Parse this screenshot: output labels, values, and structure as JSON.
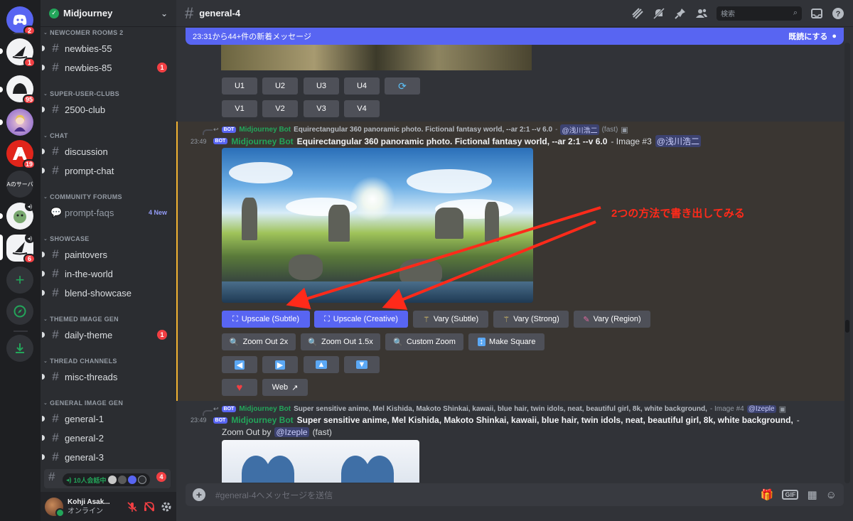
{
  "servers": [
    {
      "name": "discord-home",
      "badge": "2",
      "color": "#5865f2"
    },
    {
      "name": "server-sail",
      "badge": "1",
      "color": "#f2f3f5"
    },
    {
      "name": "server-mono",
      "badge": "95",
      "color": "#f2f3f5"
    },
    {
      "name": "server-portrait",
      "badge": "",
      "color": "#7b5ad0"
    },
    {
      "name": "server-adobe",
      "badge": "19",
      "color": "#e1251b"
    },
    {
      "name": "server-text",
      "label": "Aのサーバ",
      "badge": "",
      "color": "#313338"
    },
    {
      "name": "server-green",
      "badge": "",
      "color": "#5a8a5a"
    },
    {
      "name": "server-midjourney",
      "badge": "6",
      "color": "#f2f3f5"
    }
  ],
  "guild": {
    "name": "Midjourney"
  },
  "categories": [
    "NEWCOMER ROOMS 2",
    "SUPER-USER-CLUBS",
    "CHAT",
    "COMMUNITY FORUMS",
    "SHOWCASE",
    "THEMED IMAGE GEN",
    "THREAD CHANNELS",
    "GENERAL IMAGE GEN"
  ],
  "channels": [
    {
      "name": "newbies-55",
      "count": ""
    },
    {
      "name": "newbies-85",
      "count": "1"
    },
    {
      "name": "2500-club",
      "count": ""
    },
    {
      "name": "discussion",
      "count": ""
    },
    {
      "name": "prompt-chat",
      "count": ""
    },
    {
      "name": "prompt-faqs",
      "count": "",
      "tag": "4 New"
    },
    {
      "name": "paintovers",
      "count": ""
    },
    {
      "name": "in-the-world",
      "count": ""
    },
    {
      "name": "blend-showcase",
      "count": ""
    },
    {
      "name": "daily-theme",
      "count": "1"
    },
    {
      "name": "misc-threads",
      "count": ""
    },
    {
      "name": "general-1",
      "count": ""
    },
    {
      "name": "general-2",
      "count": ""
    },
    {
      "name": "general-3",
      "count": ""
    }
  ],
  "voice": {
    "label": "10人会話中",
    "count": "4"
  },
  "user": {
    "name": "Kohji Asak...",
    "status": "オンライン"
  },
  "topbar": {
    "channel": "general-4",
    "search_placeholder": "検索"
  },
  "banner": {
    "text": "23:31から44+件の新着メッセージ",
    "action": "既読にする"
  },
  "upper_buttons": {
    "row1": [
      "U1",
      "U2",
      "U3",
      "U4"
    ],
    "row2": [
      "V1",
      "V2",
      "V3",
      "V4"
    ]
  },
  "msg1": {
    "reply_bot": "Midjourney Bot",
    "reply_text": "Equirectangular 360 panoramic photo. Fictional fantasy world, --ar 2:1 --v 6.0",
    "reply_sep": "-",
    "reply_mention": "@浅川浩二",
    "reply_speed": "(fast)",
    "time": "23:49",
    "tag": "BOT",
    "author": "Midjourney Bot",
    "body": "Equirectangular 360 panoramic photo. Fictional fantasy world, --ar 2:1 --v 6.0",
    "meta": "- Image #3",
    "mention": "@浅川浩二"
  },
  "actions": {
    "upscale_subtle": "Upscale (Subtle)",
    "upscale_creative": "Upscale (Creative)",
    "vary_subtle": "Vary (Subtle)",
    "vary_strong": "Vary (Strong)",
    "vary_region": "Vary (Region)",
    "zoom_2x": "Zoom Out 2x",
    "zoom_15x": "Zoom Out 1.5x",
    "custom_zoom": "Custom Zoom",
    "make_square": "Make Square",
    "web": "Web"
  },
  "annotation": "2つの方法で書き出してみる",
  "msg2": {
    "reply_bot": "Midjourney Bot",
    "reply_text": "Super sensitive anime, Mel Kishida, Makoto Shinkai, kawaii, blue hair, twin idols, neat, beautiful girl, 8k, white background,",
    "reply_meta": "- Image #4",
    "reply_mention": "@Izeple",
    "time": "23:49",
    "tag": "BOT",
    "author": "Midjourney Bot",
    "body": "Super sensitive anime, Mel Kishida, Makoto Shinkai, kawaii, blue hair, twin idols, neat, beautiful girl, 8k, white background,",
    "meta": "-",
    "line2_prefix": "Zoom Out by",
    "line2_mention": "@Izeple",
    "line2_suffix": "(fast)"
  },
  "composer": {
    "placeholder": "#general-4へメッセージを送信",
    "gif": "GIF"
  },
  "colors": {
    "blurple": "#5865f2",
    "bot_green": "#23a55a",
    "highlight": "#3a3632",
    "annotation_red": "#ff2a1a"
  }
}
